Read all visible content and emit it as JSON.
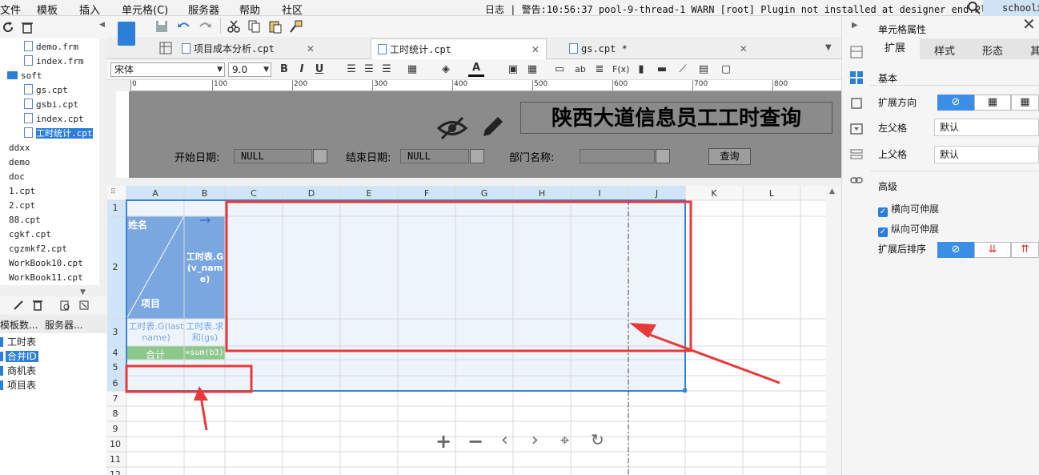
{
  "menubar": {
    "items": [
      "文件",
      "模板",
      "插入",
      "单元格(C)",
      "服务器",
      "帮助",
      "社区"
    ],
    "log_text": "日志 | 警告:10:56:37 pool-9-thread-1 WARN [root] Plugin not installed at designer end.Plugin id:c...",
    "user": "schoolxi"
  },
  "file_tree": {
    "items": [
      {
        "label": "demo.frm",
        "type": "file"
      },
      {
        "label": "index.frm",
        "type": "file"
      },
      {
        "label": "soft",
        "type": "folder"
      },
      {
        "label": "gs.cpt",
        "type": "file"
      },
      {
        "label": "gsbi.cpt",
        "type": "file"
      },
      {
        "label": "index.cpt",
        "type": "file"
      },
      {
        "label": "工时统计.cpt",
        "type": "file",
        "selected": true
      },
      {
        "label": "ddxx",
        "type": "folder"
      },
      {
        "label": "demo",
        "type": "folder"
      },
      {
        "label": "doc",
        "type": "folder"
      },
      {
        "label": "1.cpt",
        "type": "file"
      },
      {
        "label": "2.cpt",
        "type": "file"
      },
      {
        "label": "88.cpt",
        "type": "file"
      },
      {
        "label": "cgkf.cpt",
        "type": "file"
      },
      {
        "label": "cgzmkf2.cpt",
        "type": "file"
      },
      {
        "label": "WorkBook10.cpt",
        "type": "file"
      },
      {
        "label": "WorkBook11.cpt",
        "type": "file"
      }
    ]
  },
  "dataset_panel": {
    "tabs": [
      "模板数...",
      "服务器..."
    ],
    "items": [
      {
        "label": "工时表",
        "selected": false
      },
      {
        "label": "合并ID",
        "selected": true
      },
      {
        "label": "商机表",
        "selected": false
      },
      {
        "label": "项目表",
        "selected": false
      }
    ]
  },
  "tabs": [
    {
      "label": "项目成本分析.cpt",
      "active": false
    },
    {
      "label": "工时统计.cpt",
      "active": true
    },
    {
      "label": "gs.cpt *",
      "active": false
    }
  ],
  "format_toolbar": {
    "font": "宋体",
    "size": "9.0"
  },
  "ruler": {
    "labels": [
      "0",
      "100",
      "200",
      "300",
      "400",
      "500",
      "600",
      "700",
      "800"
    ]
  },
  "param_pane": {
    "title": "陕西大道信息员工工时查询",
    "start_label": "开始日期:",
    "start_value": "NULL",
    "end_label": "结束日期:",
    "end_value": "NULL",
    "dept_label": "部门名称:",
    "query_button": "查询"
  },
  "grid": {
    "columns": [
      "A",
      "B",
      "C",
      "D",
      "E",
      "F",
      "G",
      "H",
      "I",
      "J",
      "K",
      "L"
    ],
    "rows": [
      "1",
      "2",
      "3",
      "4",
      "5",
      "6",
      "7",
      "8",
      "9",
      "10",
      "11",
      "12"
    ],
    "cells": {
      "a2_top": "姓名",
      "a2_bottom": "项目",
      "b2": "工时表.G(v_name)",
      "a3": "工时表.G(lastname)",
      "b3": "工时表.求和(gs)",
      "a4": "合计",
      "b4": "=sum(b3)"
    }
  },
  "props": {
    "title": "单元格属性",
    "tabs": [
      "扩展",
      "样式",
      "形态",
      "其"
    ],
    "section_basic": "基本",
    "expand_dir": "扩展方向",
    "left_parent": "左父格",
    "left_parent_value": "默认",
    "up_parent": "上父格",
    "up_parent_value": "默认",
    "section_adv": "高级",
    "h_extend": "横向可伸展",
    "v_extend": "纵向可伸展",
    "sort_after": "扩展后排序"
  },
  "colors": {
    "accent": "#2b7fd8",
    "highlight_red": "#e8393a",
    "header_blue": "#d0e6f8",
    "cell_blue": "#7aa7e0",
    "cell_green": "#8cc78c"
  }
}
